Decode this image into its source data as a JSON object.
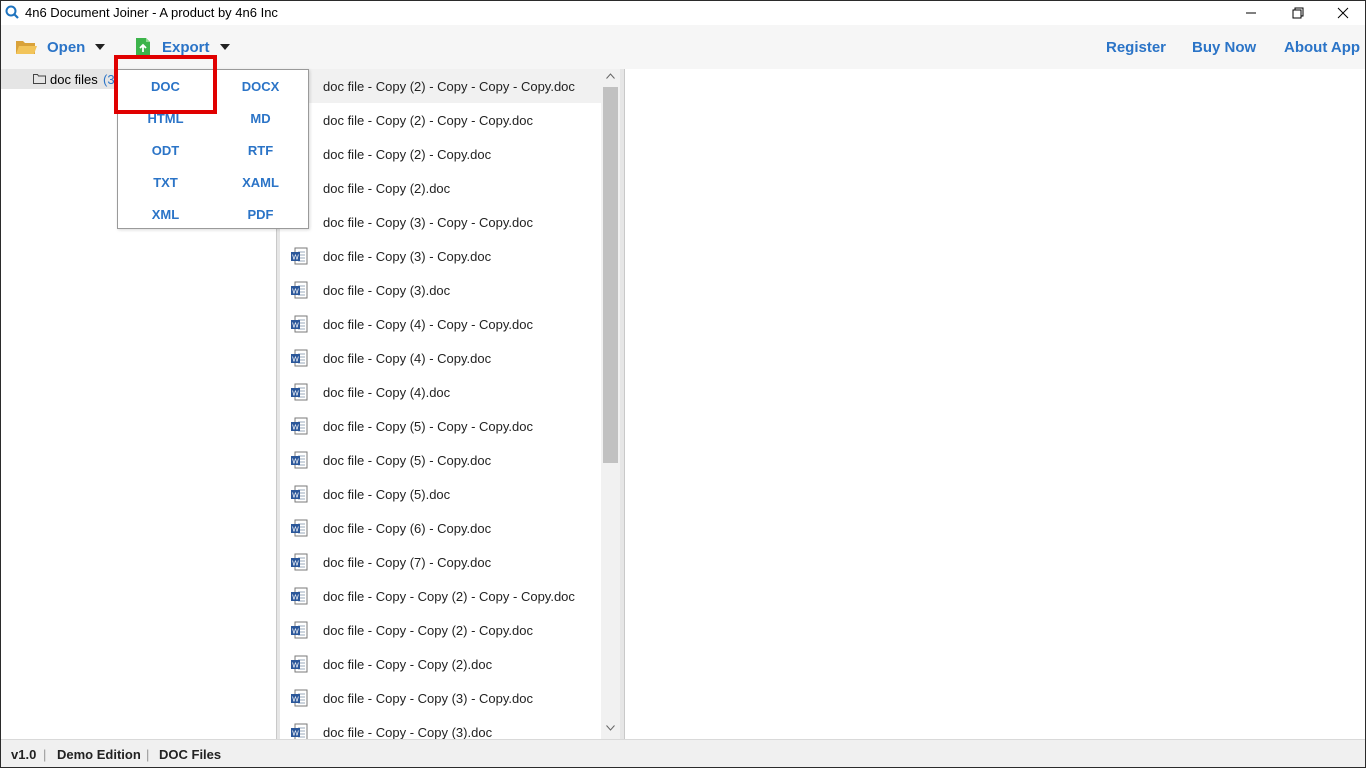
{
  "window": {
    "title": "4n6 Document Joiner - A product by 4n6 Inc"
  },
  "toolbar": {
    "open_label": "Open",
    "export_label": "Export",
    "register_label": "Register",
    "buynow_label": "Buy Now",
    "about_label": "About App"
  },
  "tree": {
    "folder_name": "doc files",
    "folder_count": "(3"
  },
  "export_menu": {
    "options": [
      "DOC",
      "DOCX",
      "HTML",
      "MD",
      "ODT",
      "RTF",
      "TXT",
      "XAML",
      "XML",
      "PDF"
    ]
  },
  "files": [
    "doc file - Copy (2) - Copy - Copy - Copy.doc",
    "doc file - Copy (2) - Copy - Copy.doc",
    "doc file - Copy (2) - Copy.doc",
    "doc file - Copy (2).doc",
    "doc file - Copy (3) - Copy - Copy.doc",
    "doc file - Copy (3) - Copy.doc",
    "doc file - Copy (3).doc",
    "doc file - Copy (4) - Copy - Copy.doc",
    "doc file - Copy (4) - Copy.doc",
    "doc file - Copy (4).doc",
    "doc file - Copy (5) - Copy - Copy.doc",
    "doc file - Copy (5) - Copy.doc",
    "doc file - Copy (5).doc",
    "doc file - Copy (6) - Copy.doc",
    "doc file - Copy (7) - Copy.doc",
    "doc file - Copy - Copy (2) - Copy - Copy.doc",
    "doc file - Copy - Copy (2) - Copy.doc",
    "doc file - Copy - Copy (2).doc",
    "doc file - Copy - Copy (3) - Copy.doc",
    "doc file - Copy - Copy (3).doc"
  ],
  "status": {
    "version": "v1.0",
    "edition": "Demo Edition",
    "mode": "DOC Files",
    "separator": "|"
  },
  "colors": {
    "accent": "#2b74c7",
    "highlight": "#e00000"
  },
  "icons": {
    "app": "search-icon",
    "folder": "folder-icon",
    "file": "word-doc-icon",
    "open": "open-folder-icon",
    "export": "export-icon"
  }
}
